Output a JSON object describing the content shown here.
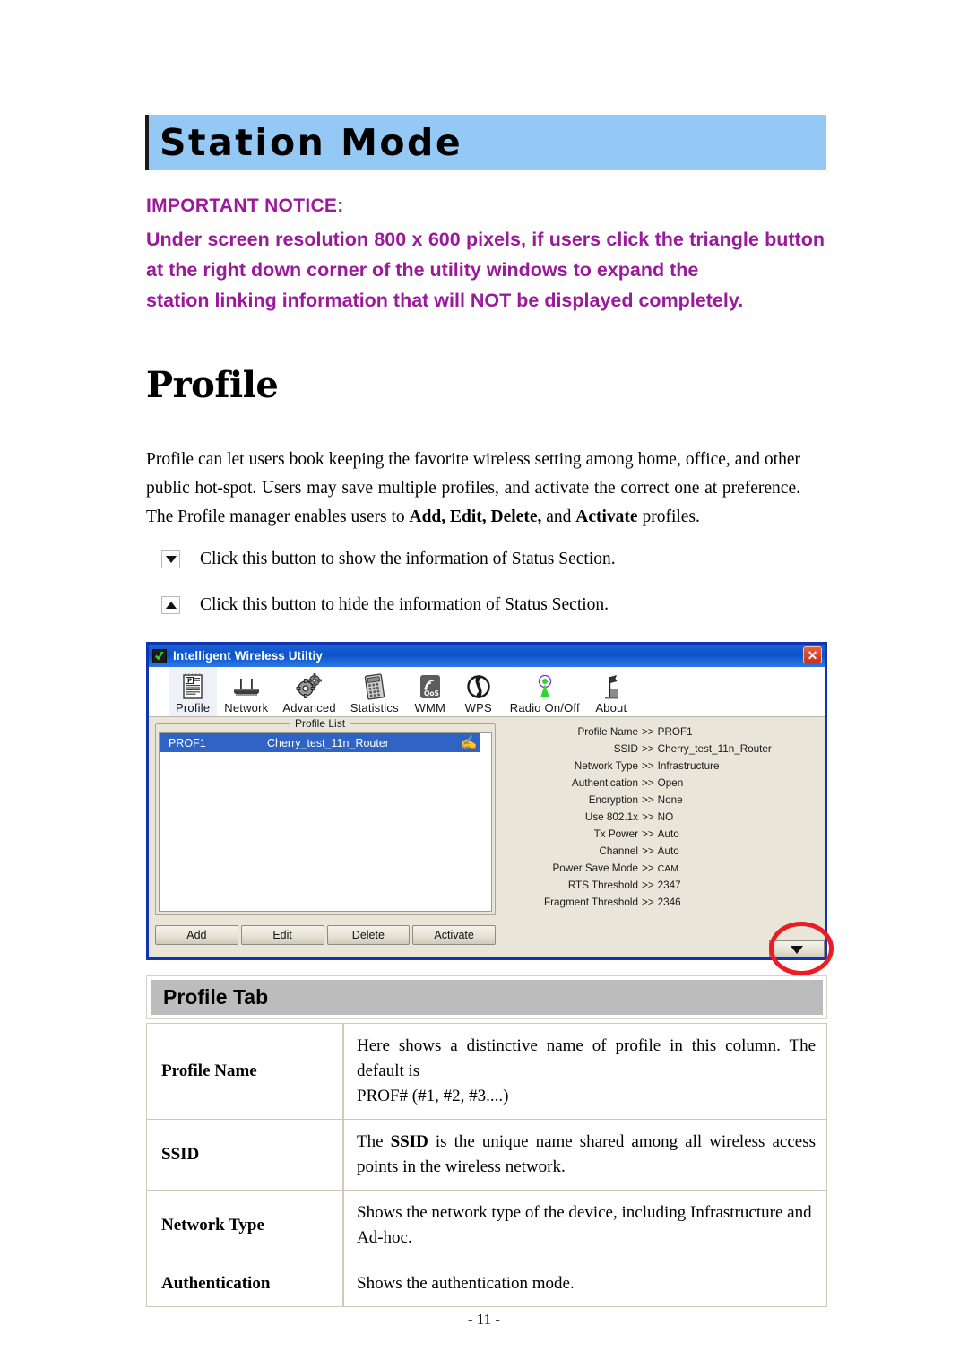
{
  "banner": {
    "title": "Station Mode"
  },
  "notice": {
    "heading": "IMPORTANT NOTICE:",
    "body": "Under screen resolution 800 x 600 pixels, if users click the triangle button at the right down corner of the utility windows to expand the",
    "body_last": "station linking information that will NOT be displayed completely."
  },
  "section": {
    "title": "Profile"
  },
  "paragraph": {
    "line1": "Profile can let users book keeping the favorite wireless setting among home, office, and other public hot-spot. Users may save multiple profiles, and activate the correct one at preference. The Profile manager enables users to ",
    "bold1": "Add, Edit, Delete,",
    "mid": " and ",
    "bold2": "Activate",
    "tail": " profiles."
  },
  "bullets": [
    {
      "icon": "triangle-down-icon",
      "text": "Click this button to show the information of Status Section."
    },
    {
      "icon": "triangle-up-icon",
      "text": "Click this button to hide the information of Status Section."
    }
  ],
  "app": {
    "title": "Intelligent Wireless Utiltiy",
    "close_label": "✕",
    "toolbar": [
      {
        "label": "Profile",
        "icon": "profile-document-icon",
        "active": true
      },
      {
        "label": "Network",
        "icon": "router-icon",
        "active": false
      },
      {
        "label": "Advanced",
        "icon": "gears-icon",
        "active": false
      },
      {
        "label": "Statistics",
        "icon": "calculator-icon",
        "active": false
      },
      {
        "label": "WMM",
        "icon": "qos-signal-icon",
        "active": false
      },
      {
        "label": "WPS",
        "icon": "wps-arrows-icon",
        "active": false
      },
      {
        "label": "Radio On/Off",
        "icon": "radio-antenna-icon",
        "active": false
      },
      {
        "label": "About",
        "icon": "about-flag-icon",
        "active": false
      }
    ],
    "profile_list": {
      "legend": "Profile List",
      "rows": [
        {
          "name": "PROF1",
          "ssid": "Cherry_test_11n_Router",
          "icon": "✍"
        }
      ]
    },
    "buttons": [
      {
        "label": "Add"
      },
      {
        "label": "Edit"
      },
      {
        "label": "Delete"
      },
      {
        "label": "Activate"
      }
    ],
    "status": [
      {
        "label": "Profile Name",
        "arrow": ">>",
        "value": "PROF1"
      },
      {
        "label": "SSID",
        "arrow": ">>",
        "value": "Cherry_test_11n_Router"
      },
      {
        "label": "Network Type",
        "arrow": ">>",
        "value": "Infrastructure"
      },
      {
        "label": "Authentication",
        "arrow": ">>",
        "value": "Open"
      },
      {
        "label": "Encryption",
        "arrow": ">>",
        "value": "None"
      },
      {
        "label": "Use 802.1x",
        "arrow": ">>",
        "value": "NO"
      },
      {
        "label": "Tx Power",
        "arrow": ">>",
        "value": "Auto"
      },
      {
        "label": "Channel",
        "arrow": ">>",
        "value": "Auto"
      },
      {
        "label": "Power Save Mode",
        "arrow": ">>",
        "value": "CAM"
      },
      {
        "label": "RTS Threshold",
        "arrow": ">>",
        "value": "2347"
      },
      {
        "label": "Fragment Threshold",
        "arrow": ">>",
        "value": "2346"
      }
    ],
    "expand_icon": "triangle-down-icon"
  },
  "profile_tab": {
    "header": "Profile Tab",
    "rows": [
      {
        "key": "Profile Name",
        "text": "Here shows a distinctive name of profile in this column. The default is",
        "text2": "PROF# (#1, #2, #3....)"
      },
      {
        "key": "SSID",
        "pre": "The ",
        "bold": "SSID",
        "post": " is the unique name shared among all wireless access points in the wireless network."
      },
      {
        "key": "Network Type",
        "text": "Shows the network type of the device, including Infrastructure and",
        "text2": "Ad-hoc."
      },
      {
        "key": "Authentication",
        "text": "Shows the authentication mode."
      }
    ]
  },
  "footer": {
    "page": "- 11 -"
  },
  "colors": {
    "banner_bg": "#95c9f5",
    "notice_text": "#9c199c",
    "titlebar_blue": "#0b52c9",
    "window_border": "#1035b0",
    "list_selected": "#2f63c4",
    "app_bg": "#e9e5d8",
    "tab_header_bg": "#bcbcbc",
    "highlight_ring": "#ec1c24"
  }
}
